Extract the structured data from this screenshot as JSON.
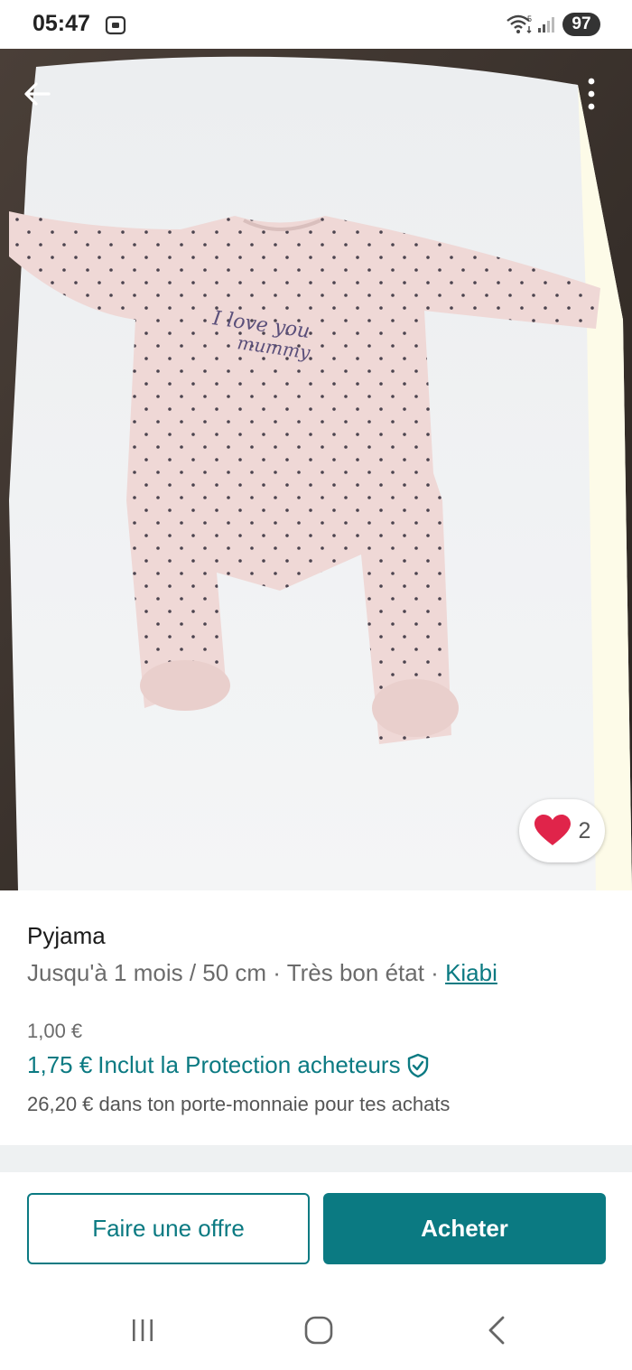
{
  "status_bar": {
    "time": "05:47",
    "battery": "97",
    "icons": [
      "screenshot-icon",
      "wifi-icon",
      "signal-icon"
    ]
  },
  "photo": {
    "print_text": "I love you mummy",
    "icons": [
      "back-arrow-icon",
      "more-vertical-icon"
    ]
  },
  "likes": {
    "count": "2",
    "icon": "heart-icon",
    "color": "#e0244a"
  },
  "item": {
    "title": "Pyjama",
    "subtitle_prefix": "Jusqu'à 1 mois / 50 cm · Très bon état · ",
    "brand": "Kiabi",
    "price": "1,00 €",
    "total_price": "1,75 €",
    "protection_text": "Inclut la Protection acheteurs",
    "protection_icon": "shield-check-icon",
    "wallet_text": "26,20 € dans ton porte-monnaie pour tes achats"
  },
  "actions": {
    "offer_label": "Faire une offre",
    "buy_label": "Acheter"
  },
  "nav": {
    "icons": [
      "recent-apps-icon",
      "home-icon",
      "back-icon"
    ]
  },
  "colors": {
    "accent": "#0b7a82",
    "heart": "#e0244a"
  }
}
